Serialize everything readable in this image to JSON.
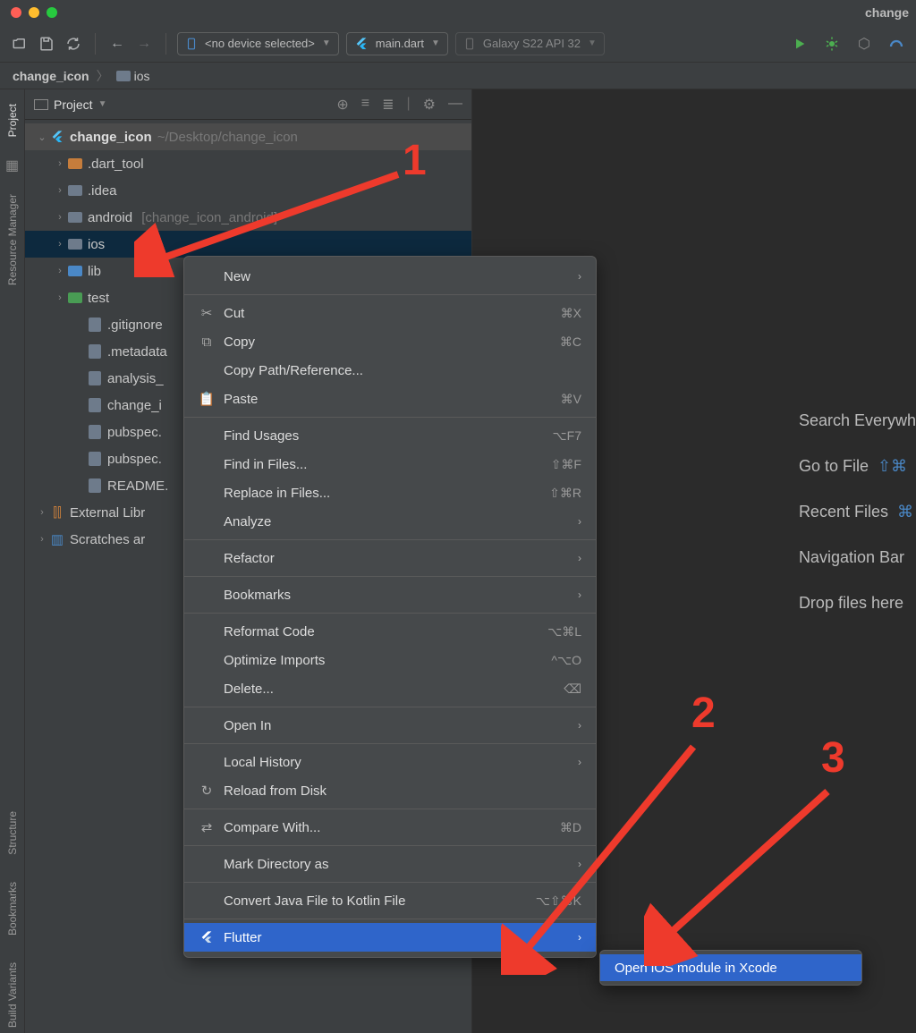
{
  "window": {
    "title": "change"
  },
  "toolbar": {
    "device_combo": "<no device selected>",
    "run_config": "main.dart",
    "emulator": "Galaxy S22  API 32"
  },
  "breadcrumb": {
    "root": "change_icon",
    "child": "ios"
  },
  "panel": {
    "title": "Project"
  },
  "tree": {
    "root": {
      "name": "change_icon",
      "path": "~/Desktop/change_icon"
    },
    "items": [
      {
        "name": ".dart_tool",
        "depth": 1,
        "arrow": true,
        "color": "orange"
      },
      {
        "name": ".idea",
        "depth": 1,
        "arrow": true,
        "color": "gray"
      },
      {
        "name": "android",
        "extra": "[change_icon_android]",
        "depth": 1,
        "arrow": true,
        "color": "gray"
      },
      {
        "name": "ios",
        "depth": 1,
        "arrow": true,
        "color": "gray",
        "selected": true
      },
      {
        "name": "lib",
        "depth": 1,
        "arrow": true,
        "color": "blue"
      },
      {
        "name": "test",
        "depth": 1,
        "arrow": true,
        "color": "green"
      },
      {
        "name": ".gitignore",
        "depth": 2,
        "file": true
      },
      {
        "name": ".metadata",
        "depth": 2,
        "file": true
      },
      {
        "name": "analysis_",
        "depth": 2,
        "file": true
      },
      {
        "name": "change_i",
        "depth": 2,
        "file": true
      },
      {
        "name": "pubspec.",
        "depth": 2,
        "file": true
      },
      {
        "name": "pubspec.",
        "depth": 2,
        "file": true
      },
      {
        "name": "README.",
        "depth": 2,
        "file": true
      }
    ],
    "external": "External Libr",
    "scratches": "Scratches ar"
  },
  "context_menu": [
    {
      "label": "New",
      "arrow": true
    },
    "sep",
    {
      "label": "Cut",
      "icon": "cut",
      "shortcut": "⌘X"
    },
    {
      "label": "Copy",
      "icon": "copy",
      "shortcut": "⌘C"
    },
    {
      "label": "Copy Path/Reference..."
    },
    {
      "label": "Paste",
      "icon": "paste",
      "shortcut": "⌘V"
    },
    "sep",
    {
      "label": "Find Usages",
      "shortcut": "⌥F7"
    },
    {
      "label": "Find in Files...",
      "shortcut": "⇧⌘F"
    },
    {
      "label": "Replace in Files...",
      "shortcut": "⇧⌘R"
    },
    {
      "label": "Analyze",
      "arrow": true
    },
    "sep",
    {
      "label": "Refactor",
      "arrow": true
    },
    "sep",
    {
      "label": "Bookmarks",
      "arrow": true
    },
    "sep",
    {
      "label": "Reformat Code",
      "shortcut": "⌥⌘L"
    },
    {
      "label": "Optimize Imports",
      "shortcut": "^⌥O"
    },
    {
      "label": "Delete...",
      "shortcut": "⌫"
    },
    "sep",
    {
      "label": "Open In",
      "arrow": true
    },
    "sep",
    {
      "label": "Local History",
      "arrow": true
    },
    {
      "label": "Reload from Disk",
      "icon": "reload"
    },
    "sep",
    {
      "label": "Compare With...",
      "icon": "compare",
      "shortcut": "⌘D"
    },
    "sep",
    {
      "label": "Mark Directory as",
      "arrow": true
    },
    "sep",
    {
      "label": "Convert Java File to Kotlin File",
      "shortcut": "⌥⇧⌘K"
    },
    "sep",
    {
      "label": "Flutter",
      "icon": "flutter",
      "arrow": true,
      "highlighted": true
    }
  ],
  "submenu": {
    "label": "Open iOS module in Xcode"
  },
  "editor_hints": [
    {
      "text": "Search Everywh"
    },
    {
      "text": "Go to File",
      "shortcut": "⇧⌘"
    },
    {
      "text": "Recent Files",
      "shortcut": "⌘"
    },
    {
      "text": "Navigation Bar"
    },
    {
      "text": "Drop files here "
    }
  ],
  "gutter": {
    "project": "Project",
    "resource": "Resource Manager",
    "structure": "Structure",
    "bookmarks": "Bookmarks",
    "build": "Build Variants"
  },
  "annotations": {
    "n1": "1",
    "n2": "2",
    "n3": "3"
  }
}
